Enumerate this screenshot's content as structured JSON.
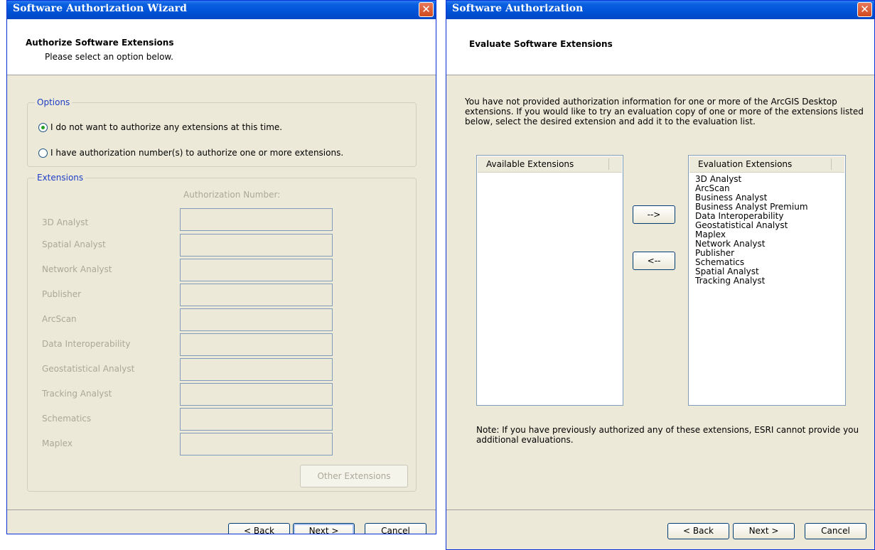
{
  "left_window": {
    "title": "Software Authorization Wizard",
    "close_glyph": "✕",
    "header_title": "Authorize Software Extensions",
    "header_subtitle": "Please select an option below.",
    "options_legend": "Options",
    "option_1": "I do not want to authorize any extensions at this time.",
    "option_2": "I have authorization number(s) to authorize one or more extensions.",
    "selected_option": 1,
    "extensions_legend": "Extensions",
    "auth_number_header": "Authorization Number:",
    "extensions": [
      "3D Analyst",
      "Spatial Analyst",
      "Network Analyst",
      "Publisher",
      "ArcScan",
      "Data Interoperability",
      "Geostatistical Analyst",
      "Tracking Analyst",
      "Schematics",
      "Maplex"
    ],
    "other_extensions_button": "Other Extensions",
    "back_button": "< Back",
    "next_button": "Next >",
    "cancel_button": "Cancel"
  },
  "right_window": {
    "title": "Software Authorization",
    "close_glyph": "✕",
    "header_title": "Evaluate Software Extensions",
    "intro_text": [
      "You have not provided authorization information for one or more of the ArcGIS Desktop",
      "extensions.  If you would like to try an evaluation copy of one or more of the extensions listed",
      "below, select the desired extension and add it to the evaluation list."
    ],
    "available_header": "Available Extensions",
    "available_items": [],
    "evaluation_header": "Evaluation Extensions",
    "evaluation_items": [
      "3D Analyst",
      "ArcScan",
      "Business Analyst",
      "Business Analyst Premium",
      "Data Interoperability",
      "Geostatistical Analyst",
      "Maplex",
      "Network Analyst",
      "Publisher",
      "Schematics",
      "Spatial Analyst",
      "Tracking Analyst"
    ],
    "add_button": "-->",
    "remove_button": "<--",
    "note_text": [
      "Note:  If you have previously authorized any of these extensions, ESRI cannot provide you",
      "additional evaluations."
    ],
    "back_button": "< Back",
    "next_button": "Next >",
    "cancel_button": "Cancel"
  }
}
